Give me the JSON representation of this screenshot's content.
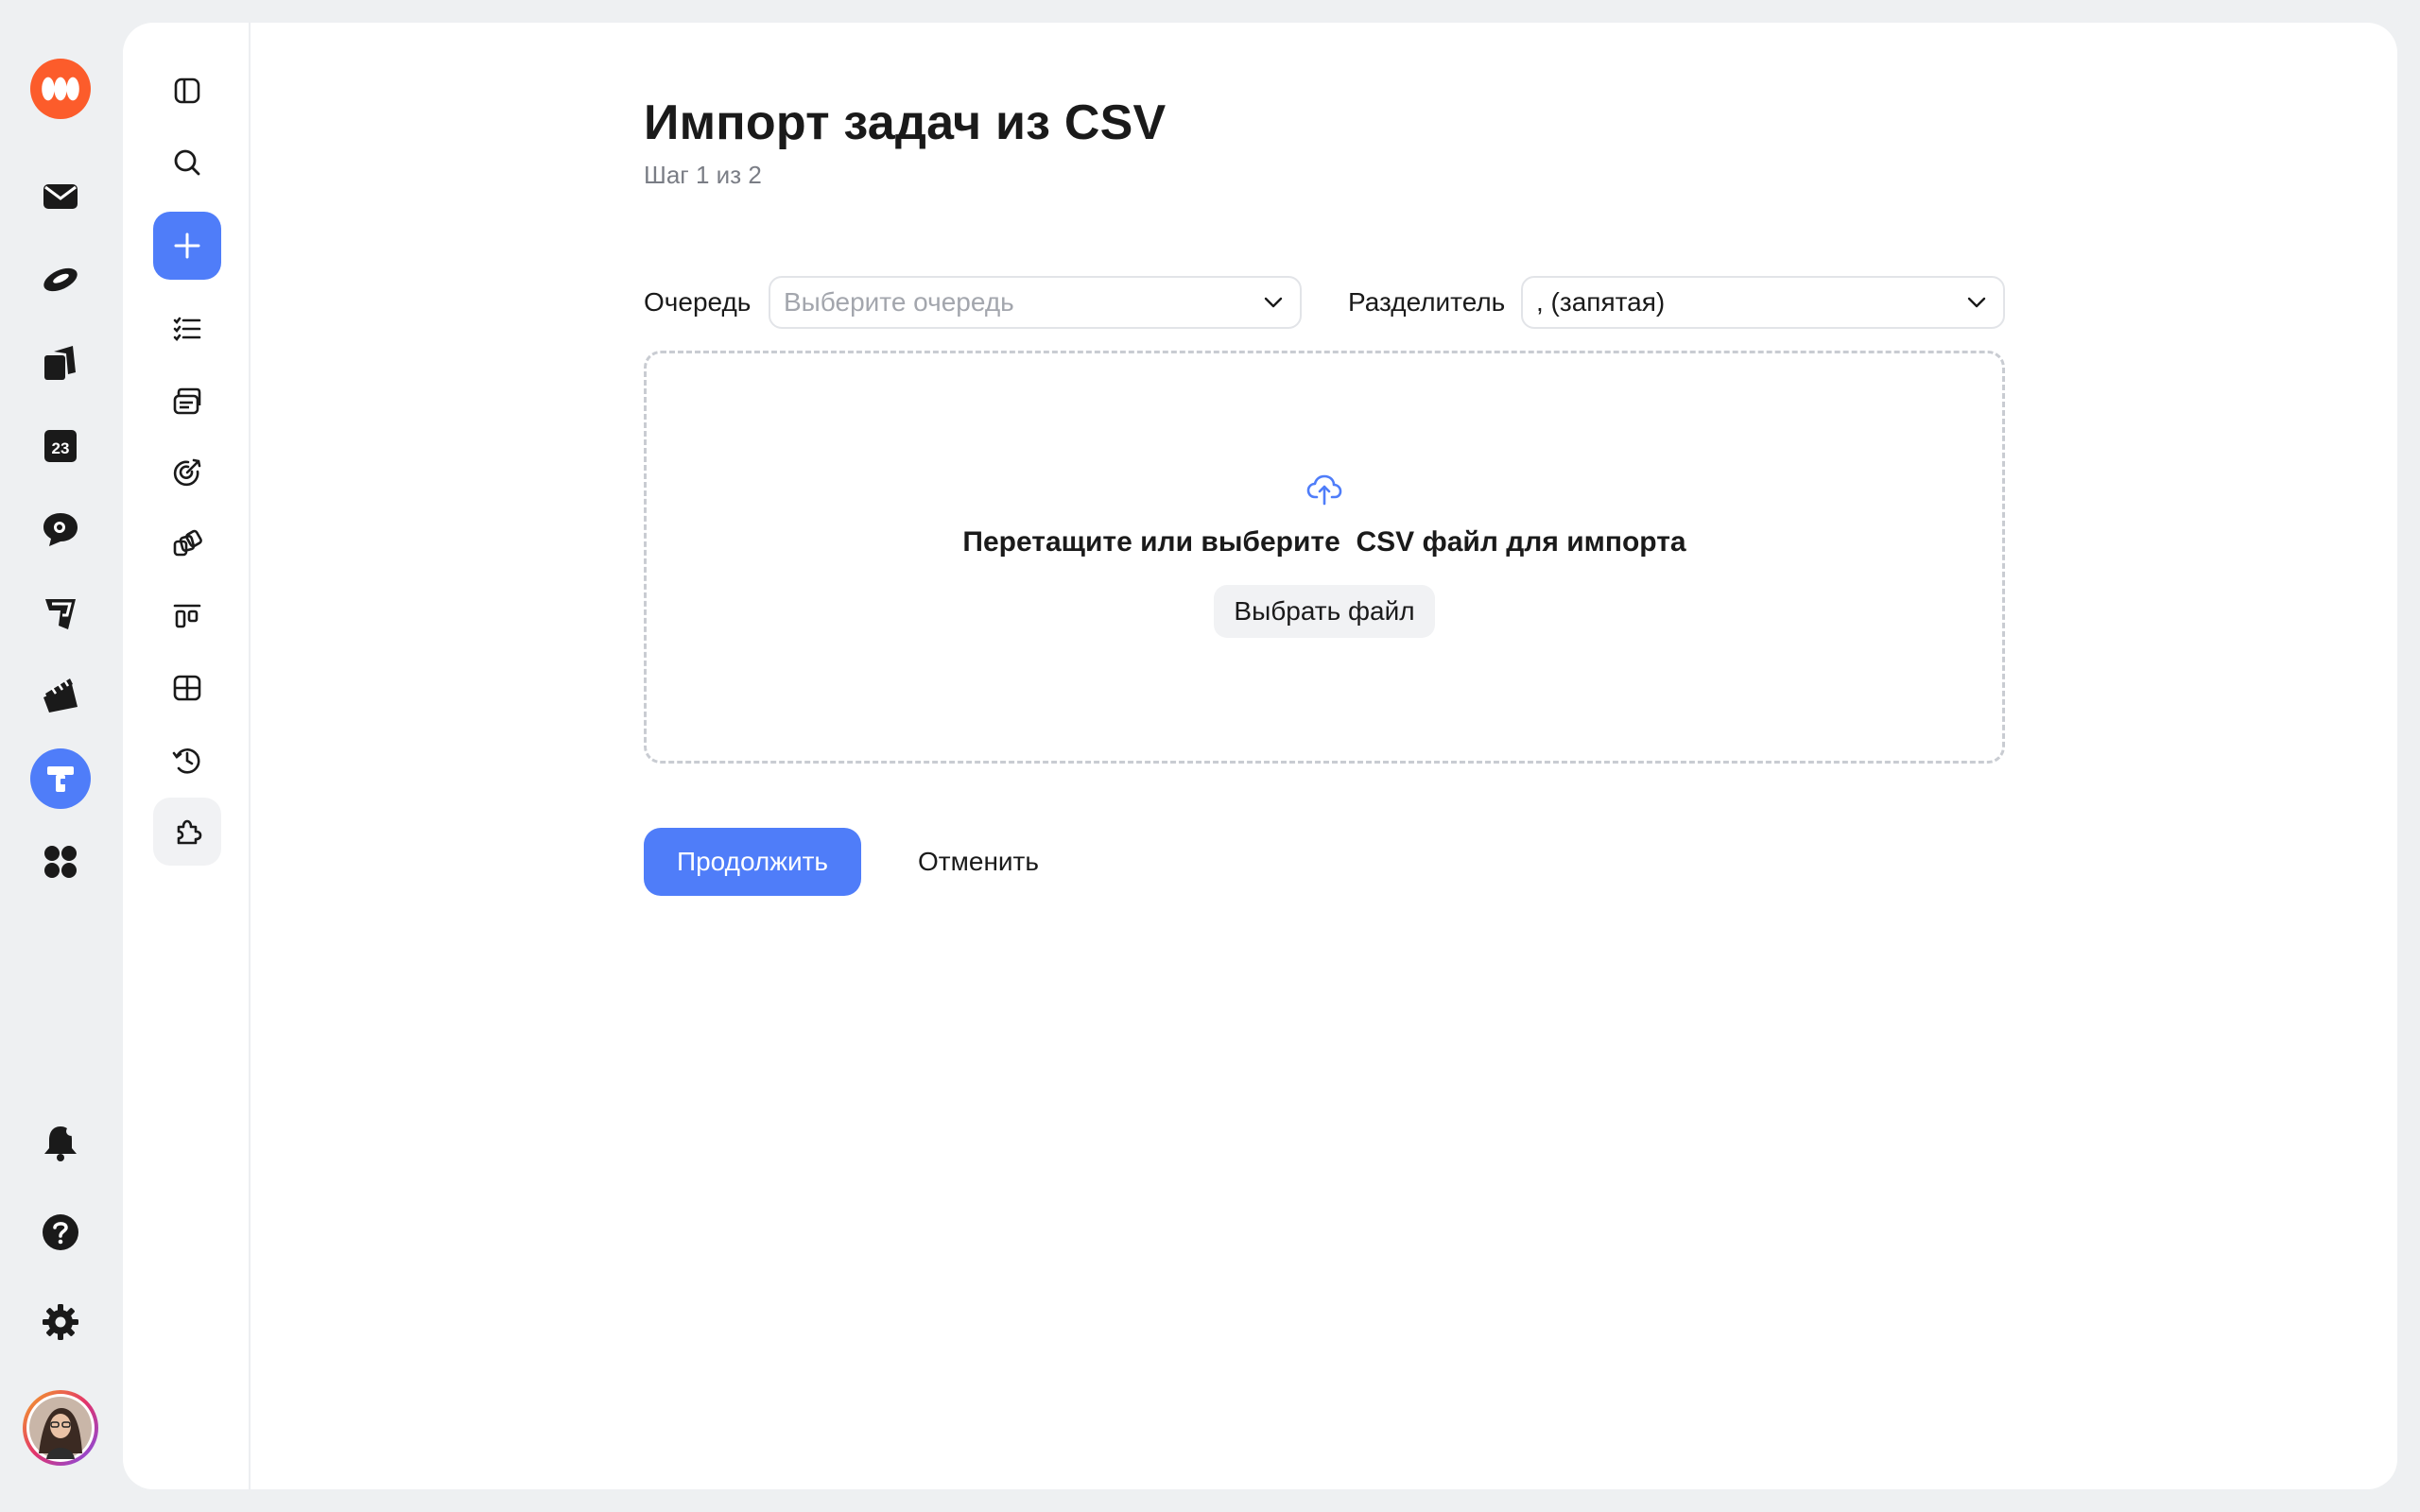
{
  "app_rail": {
    "items": [
      {
        "icon": "app-logo-icon"
      },
      {
        "icon": "mail-icon"
      },
      {
        "icon": "disk-icon"
      },
      {
        "icon": "documents-icon"
      },
      {
        "icon": "calendar-icon",
        "text": "23"
      },
      {
        "icon": "messenger-icon"
      },
      {
        "icon": "wiki-icon"
      },
      {
        "icon": "telemost-icon"
      },
      {
        "icon": "tracker-icon",
        "active": true
      },
      {
        "icon": "all-services-icon"
      }
    ],
    "bottom": [
      {
        "icon": "notifications-icon"
      },
      {
        "icon": "help-icon"
      },
      {
        "icon": "settings-icon"
      },
      {
        "icon": "user-avatar"
      }
    ]
  },
  "sidebar": {
    "items": [
      {
        "icon": "collapse-sidebar-icon"
      },
      {
        "icon": "search-icon"
      },
      {
        "icon": "create-plus-icon"
      },
      {
        "icon": "my-tasks-icon"
      },
      {
        "icon": "projects-icon"
      },
      {
        "icon": "goals-icon"
      },
      {
        "icon": "portfolio-icon"
      },
      {
        "icon": "boards-icon"
      },
      {
        "icon": "dashboards-icon"
      },
      {
        "icon": "history-icon"
      },
      {
        "icon": "extensions-icon"
      }
    ]
  },
  "page": {
    "title": "Импорт задач из CSV",
    "step": "Шаг 1 из 2",
    "queue_label": "Очередь",
    "queue_placeholder": "Выберите очередь",
    "separator_label": "Разделитель",
    "separator_value": ", (запятая)",
    "dropzone_text": "Перетащите или выберите  CSV файл для импорта",
    "choose_file_label": "Выбрать файл",
    "continue_label": "Продолжить",
    "cancel_label": "Отменить"
  },
  "colors": {
    "accent": "#4f7df9",
    "logo": "#fc5c2b",
    "background": "#eef0f2"
  }
}
